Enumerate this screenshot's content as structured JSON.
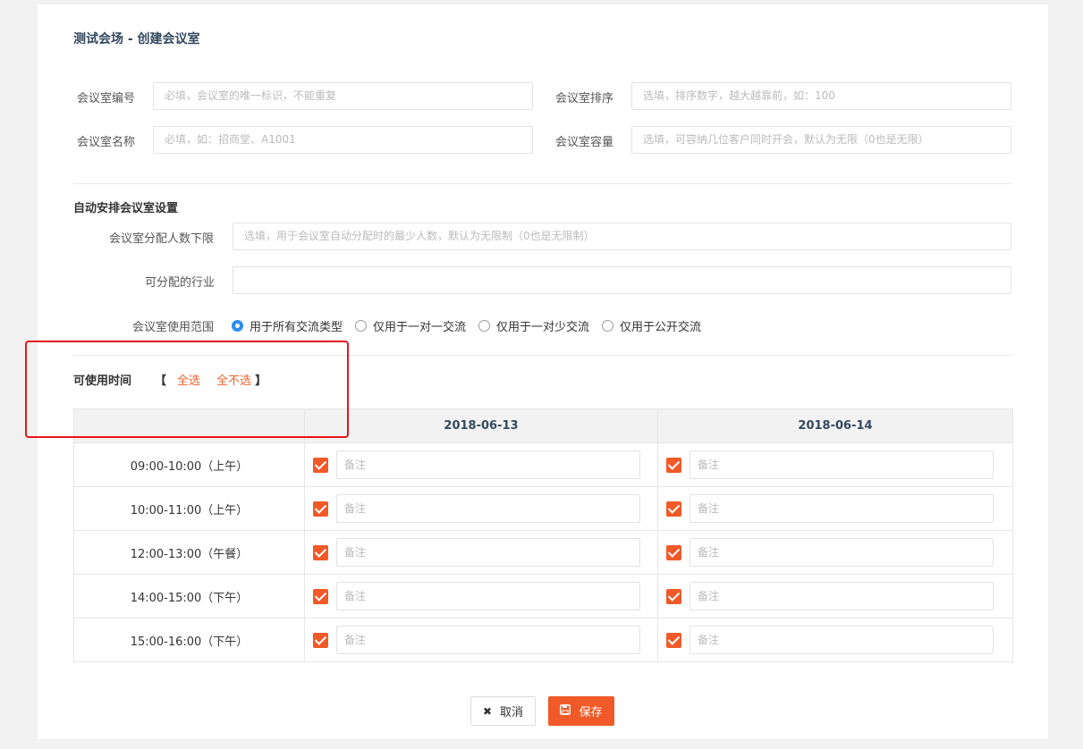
{
  "page_title": "测试会场 - 创建会议室",
  "form": {
    "room_number": {
      "label": "会议室编号",
      "placeholder": "必填，会议室的唯一标识，不能重复"
    },
    "room_order": {
      "label": "会议室排序",
      "placeholder": "选填，排序数字，越大越靠前，如：100"
    },
    "room_name": {
      "label": "会议室名称",
      "placeholder": "必填，如：招商堂、A1001"
    },
    "room_capacity": {
      "label": "会议室容量",
      "placeholder": "选填，可容纳几位客户同时开会，默认为无限（0也是无限）"
    }
  },
  "auto_section": {
    "title": "自动安排会议室设置",
    "min_people": {
      "label": "会议室分配人数下限",
      "placeholder": "选填，用于会议室自动分配时的最少人数，默认为无限制（0也是无限制）"
    },
    "industry": {
      "label": "可分配的行业",
      "placeholder": ""
    },
    "scope": {
      "label": "会议室使用范围",
      "options": [
        "用于所有交流类型",
        "仅用于一对一交流",
        "仅用于一对少交流",
        "仅用于公开交流"
      ],
      "selected": "用于所有交流类型"
    }
  },
  "time_section": {
    "title": "可使用时间",
    "bracket_open": "【",
    "select_all": "全选",
    "select_none": "全不选",
    "bracket_close": "】"
  },
  "schedule": {
    "dates": [
      "2018-06-13",
      "2018-06-14"
    ],
    "slots": [
      "09:00-10:00（上午）",
      "10:00-11:00（上午）",
      "12:00-13:00（午餐）",
      "14:00-15:00（下午）",
      "15:00-16:00（下午）"
    ],
    "note_placeholder": "备注",
    "all_checked": true
  },
  "buttons": {
    "cancel": "取消",
    "save": "保存"
  },
  "colors": {
    "accent": "#f05a28",
    "radio_selected": "#2d8cf0",
    "highlight_box": "#e5141e"
  },
  "icons": {
    "cancel": "close-icon",
    "save": "save-icon",
    "checkbox": "checkbox-checked-icon"
  }
}
